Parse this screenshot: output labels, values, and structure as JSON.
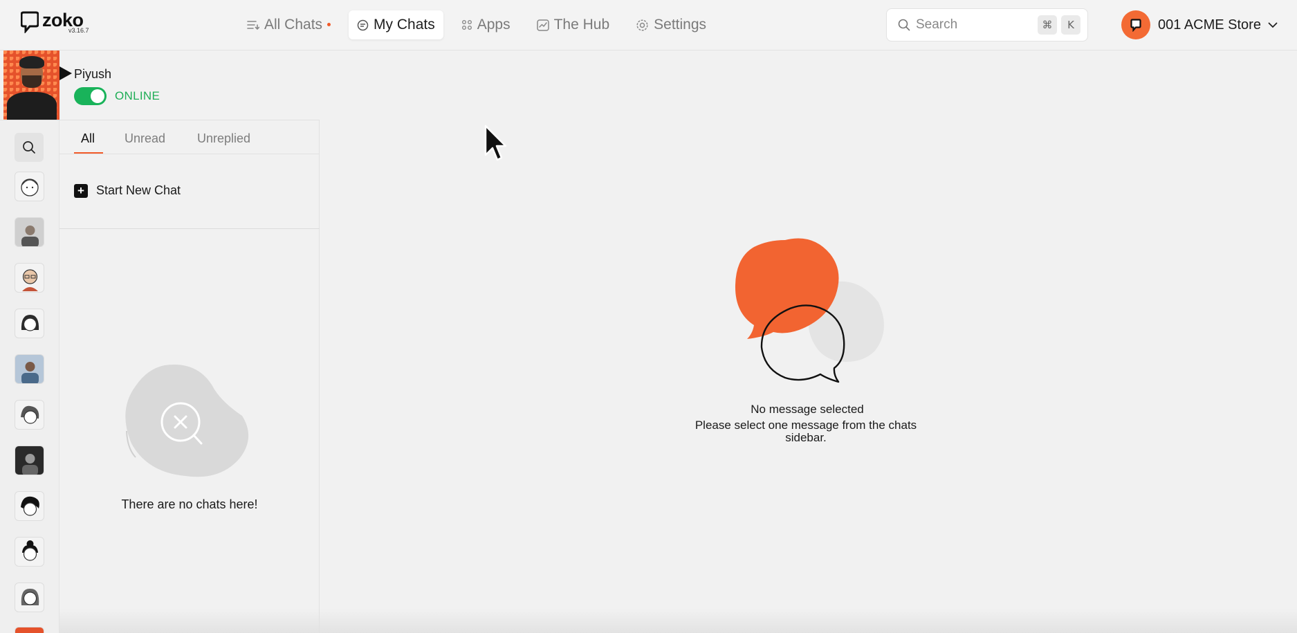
{
  "app": {
    "logo_name": "zoko",
    "version": "v3.16.7"
  },
  "nav": {
    "all_chats": "All Chats",
    "my_chats": "My Chats",
    "apps": "Apps",
    "the_hub": "The Hub",
    "settings": "Settings"
  },
  "search": {
    "placeholder": "Search",
    "shortcut_mod": "⌘",
    "shortcut_key": "K"
  },
  "store": {
    "name": "001 ACME Store"
  },
  "user": {
    "name": "Piyush",
    "status": "ONLINE"
  },
  "tabs": {
    "all": "All",
    "unread": "Unread",
    "unreplied": "Unreplied"
  },
  "chat_list": {
    "start_new_chat": "Start New Chat",
    "empty_text": "There are no chats here!"
  },
  "main": {
    "empty_title": "No message selected",
    "empty_subtitle": "Please select one message from the chats sidebar."
  },
  "colors": {
    "accent": "#f15a29",
    "online": "#19b35a"
  }
}
